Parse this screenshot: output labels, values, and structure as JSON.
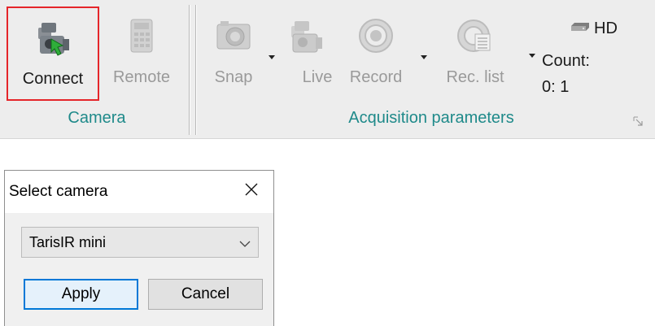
{
  "ribbon": {
    "buttons": {
      "connect": "Connect",
      "remote": "Remote",
      "snap": "Snap",
      "live": "Live",
      "record": "Record",
      "rec_list": "Rec. list"
    },
    "groups": {
      "camera": "Camera",
      "acquisition": "Acquisition parameters"
    },
    "hd_label": "HD",
    "count_label": "Count:",
    "count_value": "0: 1",
    "focused_border_color": "#e5252a",
    "group_label_color": "#1f8a8a"
  },
  "dialog": {
    "title": "Select camera",
    "combo_value": "TarisIR mini",
    "apply_label": "Apply",
    "cancel_label": "Cancel",
    "default_button_color": "#0078d7"
  },
  "icons": [
    "camera-connect-icon",
    "remote-icon",
    "snap-camera-icon",
    "live-camera-icon",
    "record-icon",
    "rec-list-icon",
    "hd-drive-icon",
    "close-icon",
    "chevron-down-icon",
    "dialog-launcher-icon"
  ]
}
